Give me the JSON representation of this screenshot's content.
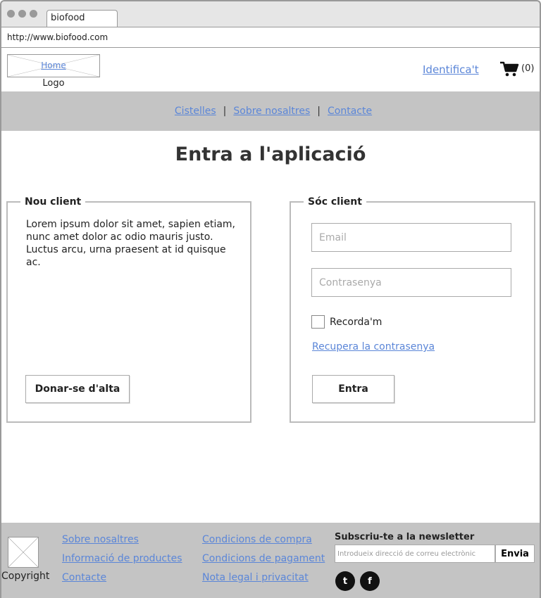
{
  "browser": {
    "tab_title": "biofood",
    "url": "http://www.biofood.com"
  },
  "header": {
    "logo_link": "Home",
    "logo_caption": "Logo",
    "login_link": "Identifica't",
    "cart_count": "(0)",
    "cart_icon": "cart-icon"
  },
  "nav": {
    "items": [
      "Cistelles",
      "Sobre nosaltres",
      "Contacte"
    ],
    "separator": "|"
  },
  "main": {
    "title": "Entra a l'aplicació",
    "new_client": {
      "legend": "Nou client",
      "text": "Lorem ipsum dolor sit amet, sapien etiam, nunc amet dolor ac odio mauris justo. Luctus arcu, urna praesent at id quisque ac.",
      "signup_label": "Donar-se d'alta"
    },
    "existing_client": {
      "legend": "Sóc client",
      "email_placeholder": "Email",
      "password_placeholder": "Contrasenya",
      "remember_label": "Recorda'm",
      "remember_checked": false,
      "recover_link": "Recupera la contrasenya",
      "login_label": "Entra"
    }
  },
  "footer": {
    "copyright": "Copyright",
    "col1": [
      "Sobre nosaltres",
      "Informació de productes",
      "Contacte"
    ],
    "col2": [
      "Condicions de compra",
      "Condicions de pagament",
      "Nota legal i privacitat"
    ],
    "newsletter_title": "Subscriu-te a la newsletter",
    "newsletter_placeholder": "Introdueix direcció de correu electrònic",
    "newsletter_button": "Envia",
    "social": [
      {
        "icon": "twitter-icon",
        "glyph": "t"
      },
      {
        "icon": "facebook-icon",
        "glyph": "f"
      }
    ]
  },
  "colors": {
    "link": "#5b86d8",
    "bar": "#c4c4c4",
    "border": "#bbbbbb"
  }
}
